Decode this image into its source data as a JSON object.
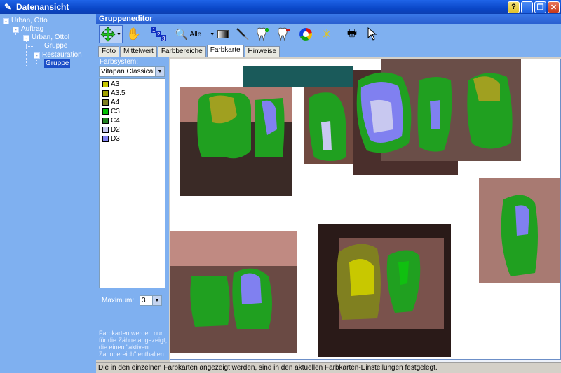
{
  "window": {
    "title": "Datenansicht",
    "help_label": "?",
    "min_label": "_",
    "restore_label": "❐",
    "close_label": "✕"
  },
  "tree": {
    "nodes": [
      {
        "label": "Urban, Otto",
        "toggle": "-"
      },
      {
        "label": "Auftrag",
        "toggle": "-"
      },
      {
        "label": "Urban, Ottol",
        "toggle": "-"
      },
      {
        "label": "Gruppe",
        "toggle": ""
      },
      {
        "label": "Restauration",
        "toggle": "-"
      },
      {
        "label": "Gruppe",
        "toggle": ""
      }
    ]
  },
  "panel": {
    "title": "Gruppeneditor"
  },
  "toolbar": {
    "zoom_label": "Alle"
  },
  "tabs": [
    "Foto",
    "Mittelwert",
    "Farbbereiche",
    "Farbkarte",
    "Hinweise"
  ],
  "active_tab": "Farbkarte",
  "left": {
    "farbsystem_label": "Farbsystem:",
    "farbsystem_value": "Vitapan Classical",
    "shades": [
      {
        "name": "A3",
        "color": "#c8c800"
      },
      {
        "name": "A3.5",
        "color": "#a0a000"
      },
      {
        "name": "A4",
        "color": "#808020"
      },
      {
        "name": "C3",
        "color": "#00c000"
      },
      {
        "name": "C4",
        "color": "#208020"
      },
      {
        "name": "D2",
        "color": "#c8c8f0"
      },
      {
        "name": "D3",
        "color": "#8080f0"
      }
    ],
    "maximum_label": "Maximum:",
    "maximum_value": "3",
    "hint": "Farbkarten werden nur für die Zähne angezeigt, die einen \"aktiven Zahnbereich\" enthalten."
  },
  "status": "Die in den einzelnen Farbkarten angezeigt werden, sind in den aktuellen Farbkarten-Einstellungen festgelegt."
}
